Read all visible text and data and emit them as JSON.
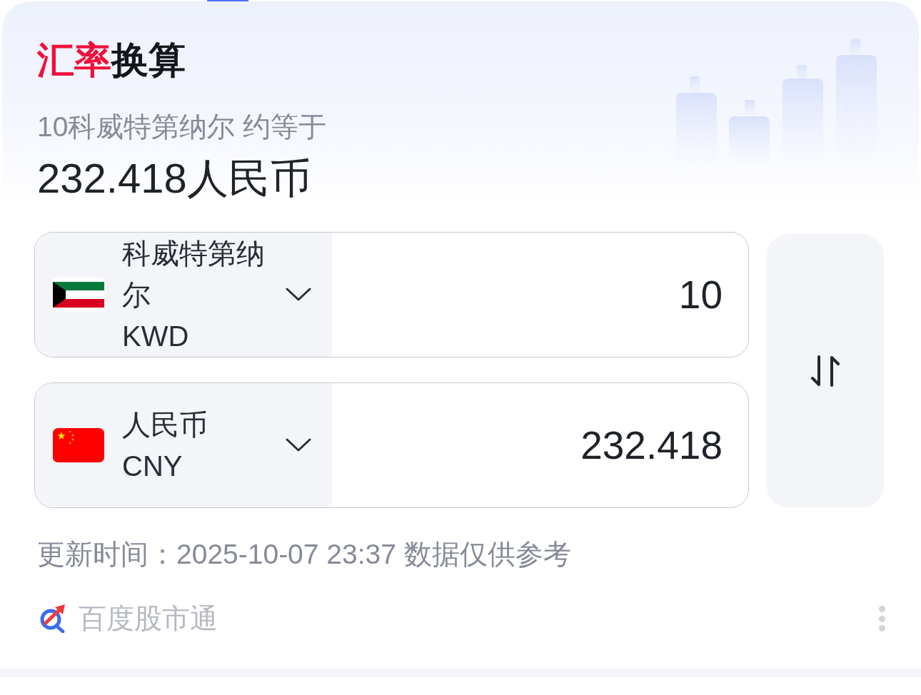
{
  "title": [
    {
      "text": "汇率",
      "accent": true
    },
    {
      "text": "换算",
      "accent": false
    }
  ],
  "summary": {
    "source": "10科威特第纳尔 约等于",
    "result": "232.418人民币"
  },
  "converter": {
    "rows": [
      {
        "kind": "kuwait",
        "currency_name": "科威特第纳尔",
        "code": "KWD",
        "amount": "10"
      },
      {
        "kind": "china",
        "currency_name": "人民币",
        "code": "CNY",
        "amount": "232.418"
      }
    ]
  },
  "footer": {
    "update_note": "更新时间：2025-10-07 23:37 数据仅供参考",
    "brand": "百度股市通"
  }
}
